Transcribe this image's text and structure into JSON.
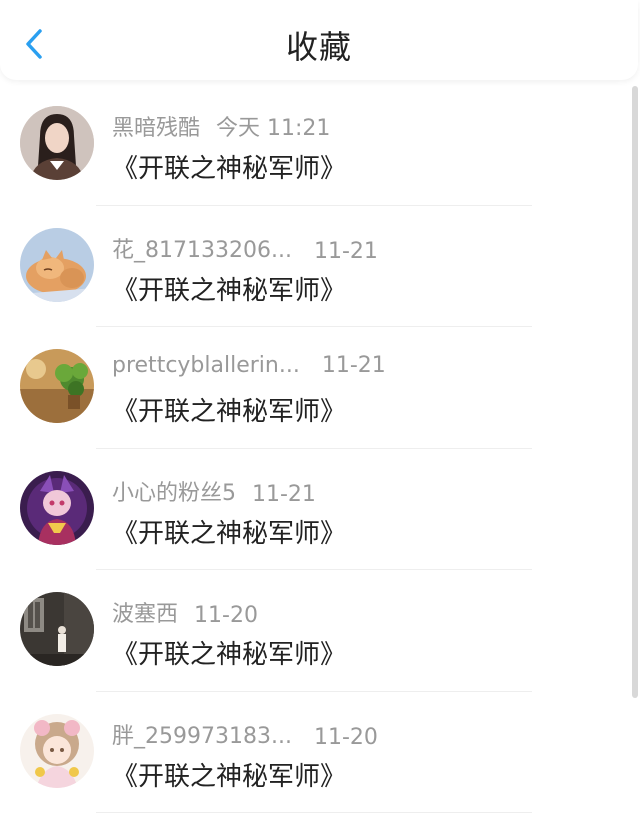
{
  "header": {
    "title": "收藏",
    "back_icon": "chevron-left-icon",
    "accent": "#2a9ff0"
  },
  "items": [
    {
      "name": "黑暗残酷",
      "time": "今天 11:21",
      "book": "《开联之神秘军师》",
      "avatar": "woman-portrait"
    },
    {
      "name": "花_817133206...",
      "time": "11-21",
      "book": "《开联之神秘军师》",
      "avatar": "sleeping-cat"
    },
    {
      "name": "prettcyblallerin...",
      "time": "11-21",
      "book": "《开联之神秘军师》",
      "avatar": "potted-plant"
    },
    {
      "name": "小心的粉丝5",
      "time": "11-21",
      "book": "《开联之神秘军师》",
      "avatar": "purple-anime-character"
    },
    {
      "name": "波塞西",
      "time": "11-20",
      "book": "《开联之神秘军师》",
      "avatar": "dark-room-figure"
    },
    {
      "name": "胖_259973183...",
      "time": "11-20",
      "book": "《开联之神秘军师》",
      "avatar": "anime-girl"
    }
  ]
}
